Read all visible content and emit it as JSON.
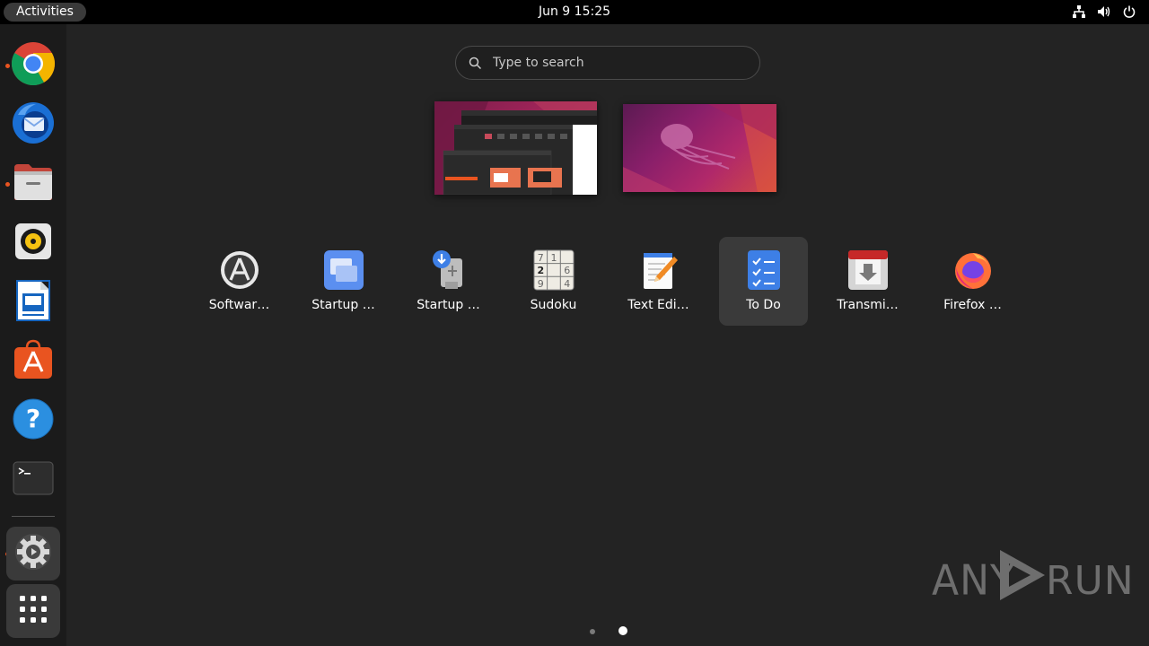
{
  "topbar": {
    "activities_label": "Activities",
    "clock": "Jun 9  15:25",
    "tray_icons": [
      "network-icon",
      "volume-icon",
      "power-icon"
    ]
  },
  "dock": {
    "items": [
      {
        "name": "Google Chrome",
        "icon": "chrome-icon",
        "running": true
      },
      {
        "name": "Thunderbird Mail",
        "icon": "thunderbird-icon",
        "running": false
      },
      {
        "name": "Files",
        "icon": "files-icon",
        "running": true
      },
      {
        "name": "Rhythmbox",
        "icon": "rhythmbox-icon",
        "running": false
      },
      {
        "name": "LibreOffice Writer",
        "icon": "writer-icon",
        "running": false
      },
      {
        "name": "Ubuntu Software",
        "icon": "ubuntu-software-icon",
        "running": false
      },
      {
        "name": "Help",
        "icon": "help-icon",
        "running": false
      },
      {
        "name": "Terminal",
        "icon": "terminal-icon",
        "running": false
      },
      {
        "name": "Settings",
        "icon": "settings-icon",
        "running": true,
        "active": true
      },
      {
        "name": "Show Applications",
        "icon": "app-grid-icon",
        "running": false
      }
    ]
  },
  "search": {
    "placeholder": "Type to search"
  },
  "apps": [
    {
      "label": "Softwar…",
      "icon": "software-updater-icon"
    },
    {
      "label": "Startup …",
      "icon": "startup-applications-icon"
    },
    {
      "label": "Startup …",
      "icon": "startup-disk-creator-icon"
    },
    {
      "label": "Sudoku",
      "icon": "sudoku-icon"
    },
    {
      "label": "Text Edi…",
      "icon": "text-editor-icon"
    },
    {
      "label": "To Do",
      "icon": "todo-icon",
      "hovered": true
    },
    {
      "label": "Transmi…",
      "icon": "transmission-icon"
    },
    {
      "label": "Firefox …",
      "icon": "firefox-icon"
    }
  ],
  "pager": {
    "pages": 2,
    "current": 2
  },
  "watermark": {
    "left": "ANY",
    "right": "RUN"
  },
  "sudoku_digits": [
    "7",
    "1",
    "",
    "2",
    "",
    "6",
    "9",
    "",
    "4"
  ],
  "colors": {
    "accent": "#e95420",
    "background": "#232323",
    "topbar": "#000000",
    "dock": "#1b1b1b"
  }
}
